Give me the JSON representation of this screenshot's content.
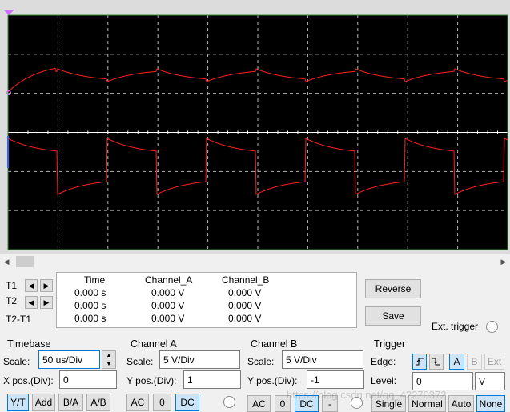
{
  "scope": {
    "colors": {
      "background": "#000000",
      "grid": "#b4b4b4",
      "trace": "#ff2020",
      "frame": "#dcdcdc"
    }
  },
  "cursors": {
    "t1_label": "T1",
    "t2_label": "T2",
    "diff_label": "T2-T1"
  },
  "readout": {
    "headers": [
      "Time",
      "Channel_A",
      "Channel_B"
    ],
    "rows": [
      [
        "0.000 s",
        "0.000 V",
        "0.000 V"
      ],
      [
        "0.000 s",
        "0.000 V",
        "0.000 V"
      ],
      [
        "0.000 s",
        "0.000 V",
        "0.000 V"
      ]
    ]
  },
  "actions": {
    "reverse": "Reverse",
    "save": "Save",
    "ext_trigger": "Ext. trigger"
  },
  "timebase": {
    "title": "Timebase",
    "scale_label": "Scale:",
    "scale_value": "50 us/Div",
    "xpos_label": "X pos.(Div):",
    "xpos_value": "0",
    "modes": [
      "Y/T",
      "Add",
      "B/A",
      "A/B"
    ]
  },
  "channel_a": {
    "title": "Channel A",
    "scale_label": "Scale:",
    "scale_value": "5  V/Div",
    "ypos_label": "Y pos.(Div):",
    "ypos_value": "1",
    "coupling": [
      "AC",
      "0",
      "DC"
    ]
  },
  "channel_b": {
    "title": "Channel B",
    "scale_label": "Scale:",
    "scale_value": "5  V/Div",
    "ypos_label": "Y pos.(Div):",
    "ypos_value": "-1",
    "coupling": [
      "AC",
      "0",
      "DC",
      "-"
    ]
  },
  "trigger": {
    "title": "Trigger",
    "edge_label": "Edge:",
    "source": [
      "A",
      "B",
      "Ext"
    ],
    "level_label": "Level:",
    "level_value": "0",
    "level_unit": "V",
    "modes": [
      "Single",
      "Normal",
      "Auto",
      "None"
    ]
  },
  "watermark": "https://blog.csdn.net/qq_42270372"
}
